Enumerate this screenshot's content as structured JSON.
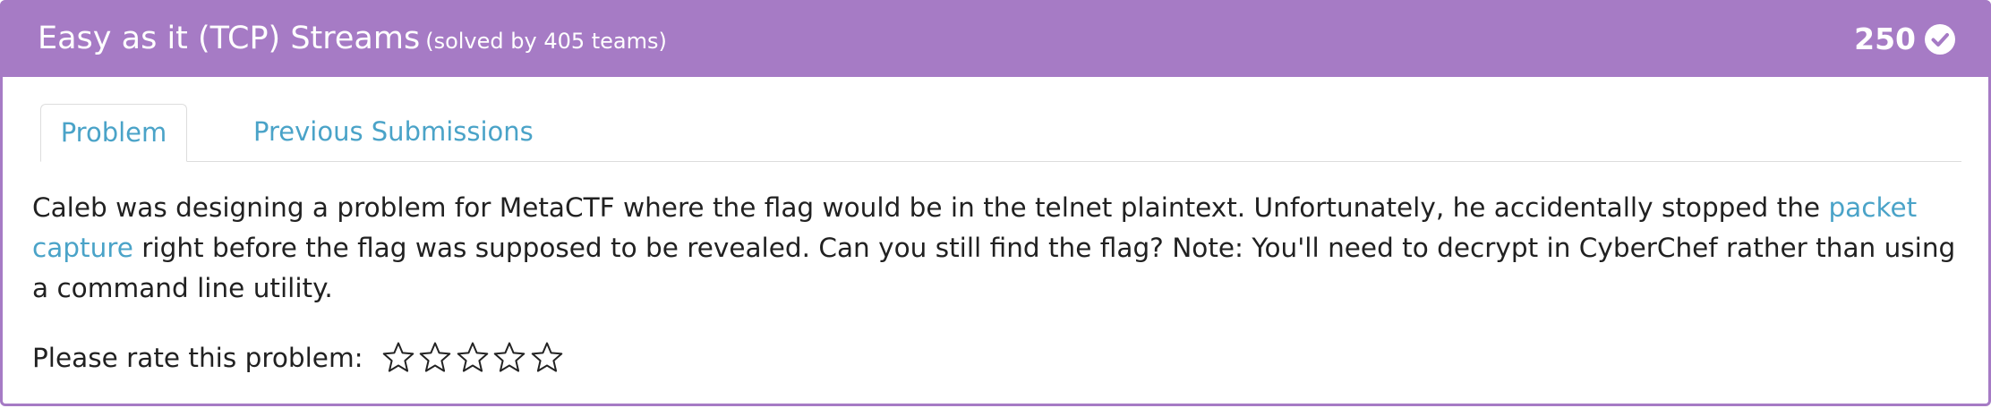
{
  "problem": {
    "title": "Easy as it (TCP) Streams",
    "solved_text": "(solved by 405 teams)",
    "points": "250",
    "status_icon": "check-circle-icon"
  },
  "tabs": [
    {
      "label": "Problem",
      "active": true
    },
    {
      "label": "Previous Submissions",
      "active": false
    }
  ],
  "description": {
    "text_before_link": "Caleb was designing a problem for MetaCTF where the flag would be in the telnet plaintext. Unfortunately, he accidentally stopped the ",
    "link_text": "packet capture",
    "text_after_link": " right before the flag was supposed to be revealed. Can you still find the flag? Note: You'll need to decrypt in CyberChef rather than using a command line utility."
  },
  "rating": {
    "label": "Please rate this problem:",
    "stars_selected": 0,
    "stars_total": 5
  },
  "colors": {
    "header_bg": "#a67bc5",
    "header_text": "#ffffff",
    "link": "#4aa3c8",
    "body_text": "#212121"
  }
}
